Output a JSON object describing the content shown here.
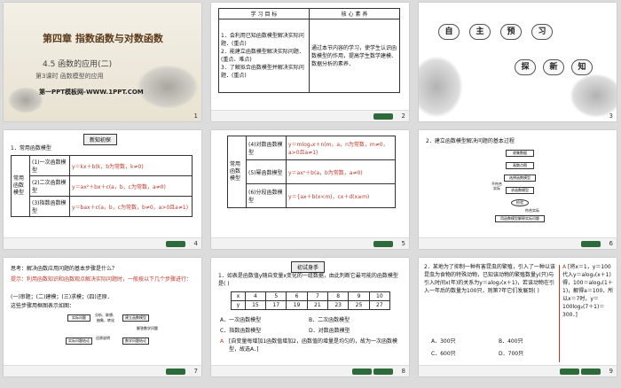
{
  "slide_numbers": [
    "1",
    "2",
    "3",
    "4",
    "5",
    "6",
    "7",
    "8",
    "9"
  ],
  "slide1": {
    "chapter": "第四章    指数函数与对数函数",
    "section": "4.5    函数的应用(二)",
    "lesson": "第3课时    函数模型的应用",
    "brand": "第一PPT模板网-WWW.1PPT.COM"
  },
  "slide2": {
    "headers": [
      "学 习 目 标",
      "核 心 素 养"
    ],
    "goals": [
      "1．会利用已知函数模型解决实际问题．(重点)",
      "2．能建立函数模型解决实际问题．(重点、难点)",
      "3．了解拟合函数模型并解决实际问题．(重点)"
    ],
    "literacy": "通过本节内容的学习，使学生认识函数模型的作用，提高学生数学建模、数据分析的素养．"
  },
  "slide3": {
    "pill1": [
      "自",
      "主",
      "预",
      "习"
    ],
    "pill2": [
      "探",
      "新",
      "知"
    ]
  },
  "slide4": {
    "tag": "新知初探",
    "heading": "1．常用函数模型",
    "side": "常用函数模型",
    "rows": [
      {
        "name": "(1)一次函数模型",
        "formula": "y＝kx＋b(k，b为常数，k≠0)"
      },
      {
        "name": "(2)二次函数模型",
        "formula": "y＝ax²＋bx＋c(a，b，c为常数，a≠0)"
      },
      {
        "name": "(3)指数函数模型",
        "formula": "y＝bax＋c(a，b，c为常数，b≠0，a>0且a≠1)"
      }
    ]
  },
  "slide5": {
    "side": "常用函数模型",
    "rows": [
      {
        "name": "(4)对数函数模型",
        "formula": "y＝mlogₐx＋n(m，a，n为常数，m≠0，a>0且a≠1)"
      },
      {
        "name": "(5)幂函数模型",
        "formula": "y＝axⁿ＋b(a，b为常数，a≠0)"
      },
      {
        "name": "(6)分段函数模型",
        "formula": "y＝{ax＋b(x<m)，cx＋d(x≥m)"
      }
    ]
  },
  "slide6": {
    "heading": "2．建立函数模型解决问题的基本过程",
    "boxes": [
      "收集数据",
      "画散点图",
      "选择函数模型",
      "求函数模型",
      "检验",
      "用函数模型解释实际问题"
    ],
    "labels": [
      "不符合实际",
      "符合实际"
    ]
  },
  "slide7": {
    "question": "思考：解决函数应用问题的基本步骤是什么？",
    "hint": "提示：利用函数知识和函数观点解决实际问题时，一般按以下几个步骤进行：",
    "steps": "(一)审题；(二)建模；(三)求模；(四)还原．",
    "diagram_caption": "这些步骤用框图表示如图：",
    "boxes": [
      "实际问题",
      "分析、联想、抽象、转化",
      "建立函数模型",
      "实际问题结论",
      "还原说明",
      "数学问题结论",
      "解答数学问题"
    ]
  },
  "slide8": {
    "tag": "初试身手",
    "question": "1．如表是函数值y随自变量x变化的一组数据，由此判断它最可能的函数模型是(    )",
    "table_x": [
      "x",
      "4",
      "5",
      "6",
      "7",
      "8",
      "9",
      "10"
    ],
    "table_y": [
      "y",
      "15",
      "17",
      "19",
      "21",
      "23",
      "25",
      "27"
    ],
    "options": [
      "A．一次函数模型",
      "B．二次函数模型",
      "C．指数函数模型",
      "D．对数函数模型"
    ],
    "answer": "A",
    "explain": "[自变量每增加1函数值增加2，函数值的增量是均匀的，故为一次函数模型，故选A．]"
  },
  "slide9": {
    "question": "2．某地为了抑制一种有害昆虫的繁殖，引入了一种以该昆虫为食物的特殊动物，已知该动物的繁殖数量y(只)与引入时间x(年)的关系为y＝alog₂(x＋1)，若该动物在引入一年后的数量为100只，则第7年它们发展到(    )",
    "options": [
      "A．300只",
      "B．400只",
      "C．600只",
      "D．700只"
    ],
    "answer": "A",
    "explain": "[将x＝1，y＝100代入y＝alog₂(x＋1)得，100＝alog₂(1＋1)，解得a＝100．所以x＝7时，y＝100log₂(7＋1)＝300．]"
  }
}
